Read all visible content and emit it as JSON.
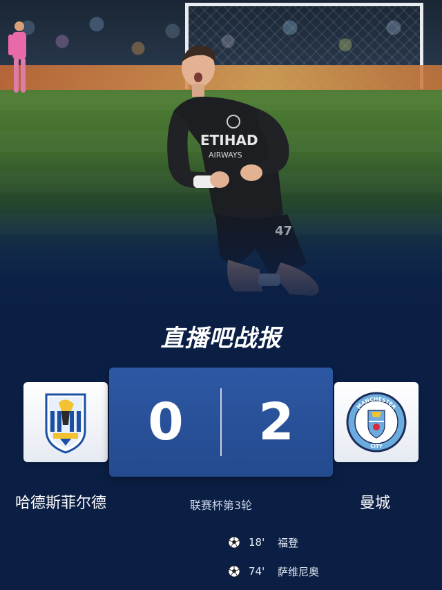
{
  "brand": {
    "text_main": "直播吧战",
    "text_bolt": "报"
  },
  "match": {
    "home_team": "哈德斯菲尔德",
    "away_team": "曼城",
    "home_score": "0",
    "away_score": "2",
    "round": "联赛杯第3轮",
    "goals": [
      {
        "minute": "18'",
        "player": "福登"
      },
      {
        "minute": "74'",
        "player": "萨维尼奥"
      }
    ]
  },
  "hero": {
    "sponsor_line1": "ETIHAD",
    "sponsor_line2": "AIRWAYS",
    "shirt_number": "47"
  },
  "badges": {
    "away_top": "MANCHESTER",
    "away_bottom": "CITY"
  },
  "icons": {
    "goal": "soccer-ball-icon",
    "home_crest": "huddersfield-crest-icon",
    "away_crest": "man-city-crest-icon"
  },
  "colors": {
    "background": "#0b1f45",
    "score_box": "#2d58a4",
    "accent": "#2f7cf6"
  }
}
